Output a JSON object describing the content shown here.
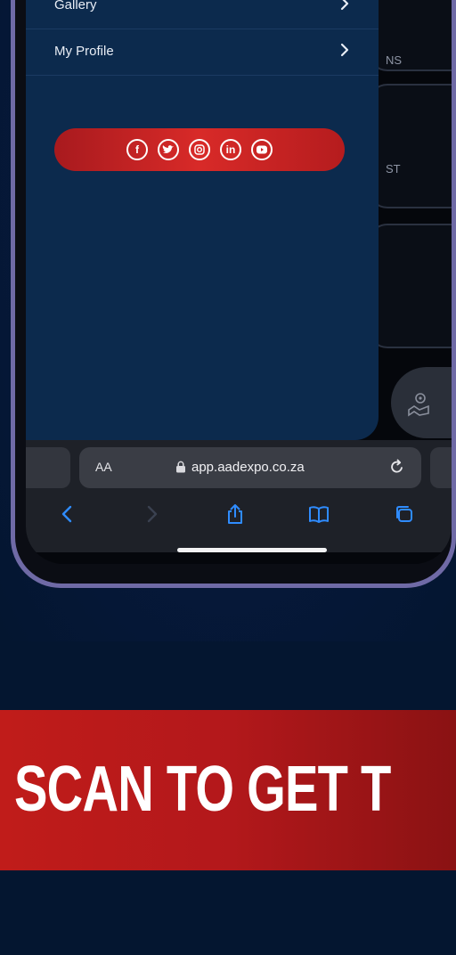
{
  "menu": {
    "items": [
      {
        "label": "Gallery"
      },
      {
        "label": "My Profile"
      }
    ],
    "social_icons": [
      "facebook-icon",
      "twitter-icon",
      "instagram-icon",
      "linkedin-icon",
      "youtube-icon"
    ],
    "social_bar_color": "#d82a28"
  },
  "background_app": {
    "tile1_text": "NS",
    "tile2_text": "ST"
  },
  "safari": {
    "text_size_label": "AA",
    "url": "app.aadexpo.co.za"
  },
  "banner": {
    "text": "SCAN TO GET T",
    "color": "#c01c1a"
  },
  "colors": {
    "page_background": "#041630",
    "menu_background": "#0c2a4d",
    "accent_blue": "#2f8cff"
  }
}
